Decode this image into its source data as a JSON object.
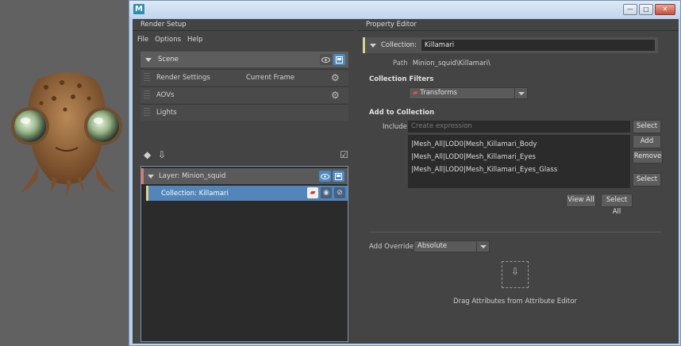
{
  "window": {
    "app_icon_letter": "M",
    "buttons": [
      "minimize-icon",
      "maximize-icon",
      "close-icon"
    ]
  },
  "left_panel": {
    "tab": "Render Setup",
    "menu": [
      "File",
      "Options",
      "Help"
    ],
    "scene": {
      "label": "Scene"
    },
    "rows": [
      {
        "label": "Render Settings",
        "extra": "Current Frame",
        "icon": "gear-icon"
      },
      {
        "label": "AOVs",
        "extra": "",
        "icon": "gear-icon"
      },
      {
        "label": "Lights",
        "extra": "",
        "icon": ""
      }
    ],
    "layer": {
      "label": "Layer:  Minion_squid"
    },
    "collection": {
      "label": "Collection:  Killamari"
    }
  },
  "right_panel": {
    "tab": "Property Editor",
    "collection_label": "Collection:",
    "collection_name": "Killamari",
    "path_label": "Path",
    "path_value": "Minion_squid\\Killamari\\",
    "filters_title": "Collection Filters",
    "filter_value": "Transforms",
    "add_title": "Add to Collection",
    "include_label": "Include",
    "include_placeholder": "Create expression",
    "select_label": "Select",
    "add_label": "Add",
    "remove_label": "Remove",
    "select2_label": "Select",
    "members": [
      "|Mesh_All|LOD0|Mesh_Killamari_Body",
      "|Mesh_All|LOD0|Mesh_Killamari_Eyes",
      "|Mesh_All|LOD0|Mesh_Killamari_Eyes_Glass"
    ],
    "view_all_label": "View All",
    "select_all_label": "Select All",
    "override_label": "Add Override",
    "override_value": "Absolute",
    "drag_hint": "Drag Attributes from Attribute Editor"
  },
  "colors": {
    "layer_accent": "#e0796c",
    "collection_accent": "#d7d48a",
    "selection": "#5285b9"
  }
}
